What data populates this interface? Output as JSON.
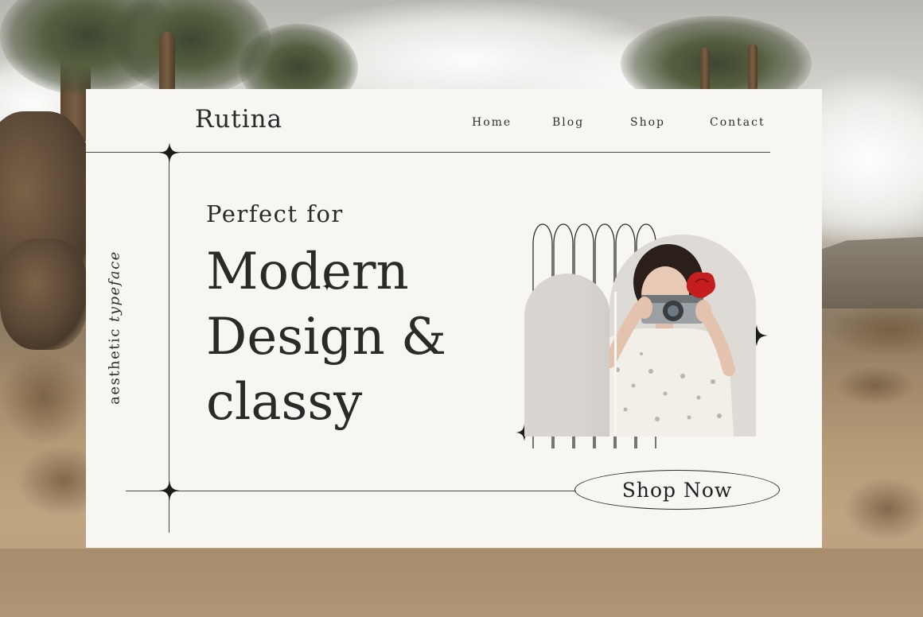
{
  "brand": {
    "name": "Rutina"
  },
  "nav": {
    "items": [
      {
        "label": "Home"
      },
      {
        "label": "Blog"
      },
      {
        "label": "Shop"
      },
      {
        "label": "Contact"
      }
    ]
  },
  "hero": {
    "kicker": "Perfect for",
    "headline_lines": [
      "Modern",
      "Design &",
      "classy"
    ],
    "caption_prefix": "aesthetic",
    "caption_italic": "typeface",
    "cta_label": "Shop Now"
  },
  "icons": {
    "sparkle": "four-point-star-icon"
  },
  "colors": {
    "card_background": "#f8f6f2",
    "ink": "#2a2a28",
    "dress": "#f2efe8",
    "flower": "#c41e1e",
    "camera": "#9aa0a4"
  }
}
